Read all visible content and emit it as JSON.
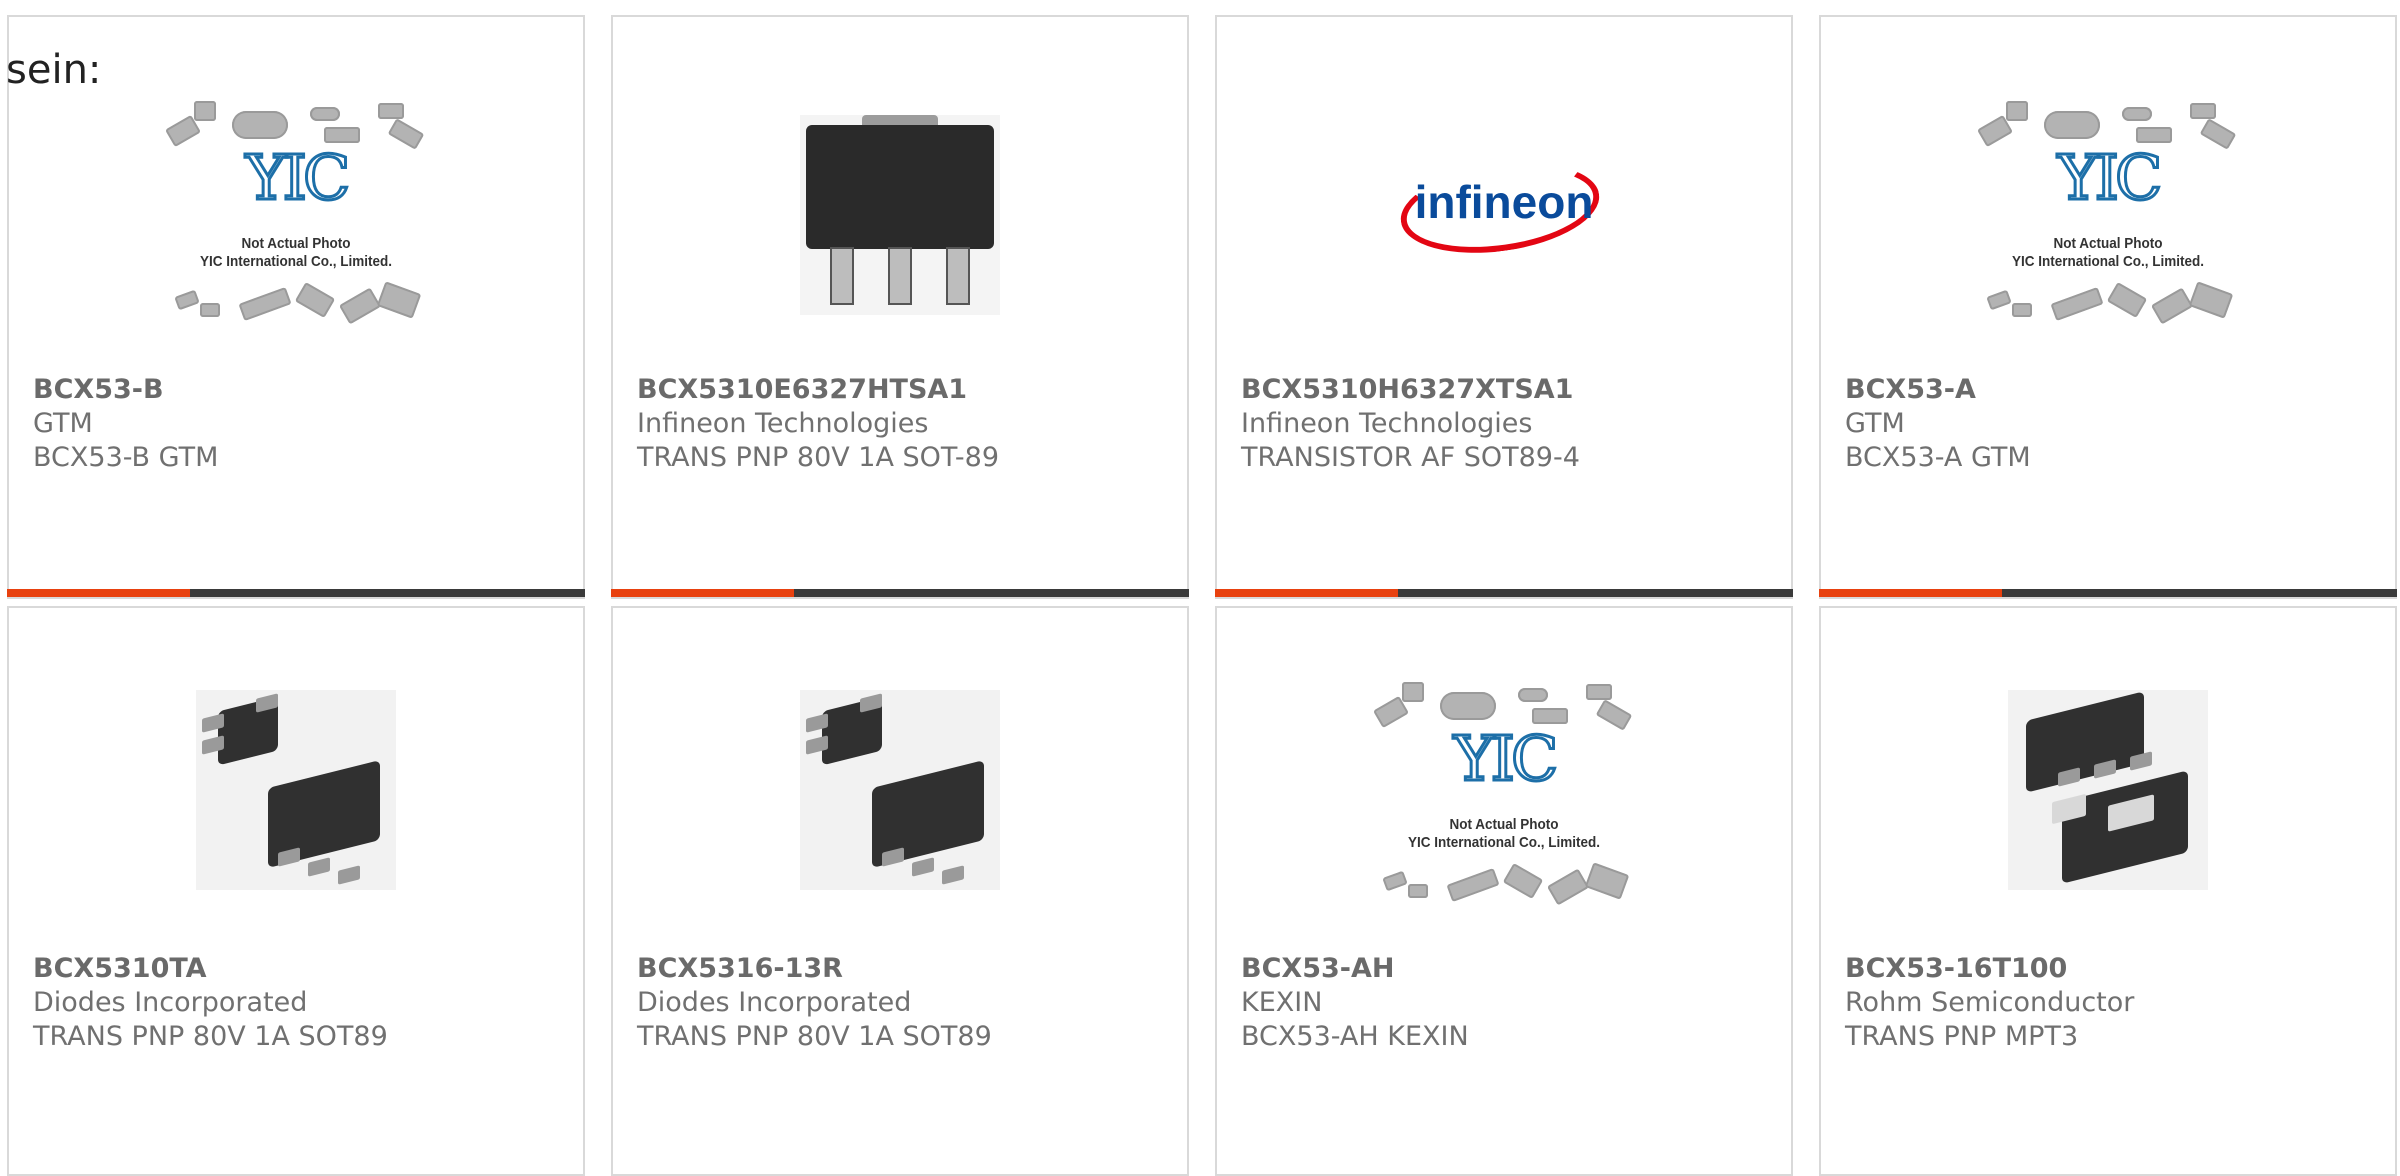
{
  "intro_text": "sein:",
  "colors": {
    "accent": "#e8410f",
    "bar": "#3a3a3a",
    "border": "#d9d9d9"
  },
  "placeholder": {
    "logo": "YIC",
    "line1": "Not Actual Photo",
    "line2": "YIC International Co., Limited."
  },
  "infineon_logo": "infineon",
  "products": [
    {
      "part_number": "BCX53-B",
      "manufacturer": "GTM",
      "description": "BCX53-B GTM",
      "image": "yic-placeholder"
    },
    {
      "part_number": "BCX5310E6327HTSA1",
      "manufacturer": "Infineon Technologies",
      "description": "TRANS PNP 80V 1A SOT-89",
      "image": "sot89-package"
    },
    {
      "part_number": "BCX5310H6327XTSA1",
      "manufacturer": "Infineon Technologies",
      "description": "TRANSISTOR AF SOT89-4",
      "image": "infineon-logo"
    },
    {
      "part_number": "BCX53-A",
      "manufacturer": "GTM",
      "description": "BCX53-A GTM",
      "image": "yic-placeholder"
    },
    {
      "part_number": "BCX5310TA",
      "manufacturer": "Diodes Incorporated",
      "description": "TRANS PNP 80V 1A SOT89",
      "image": "sot89-diagonal"
    },
    {
      "part_number": "BCX5316-13R",
      "manufacturer": "Diodes Incorporated",
      "description": "TRANS PNP 80V 1A SOT89",
      "image": "sot89-diagonal"
    },
    {
      "part_number": "BCX53-AH",
      "manufacturer": "KEXIN",
      "description": "BCX53-AH KEXIN",
      "image": "yic-placeholder"
    },
    {
      "part_number": "BCX53-16T100",
      "manufacturer": "Rohm Semiconductor",
      "description": "TRANS PNP MPT3",
      "image": "mpt3-package"
    }
  ]
}
